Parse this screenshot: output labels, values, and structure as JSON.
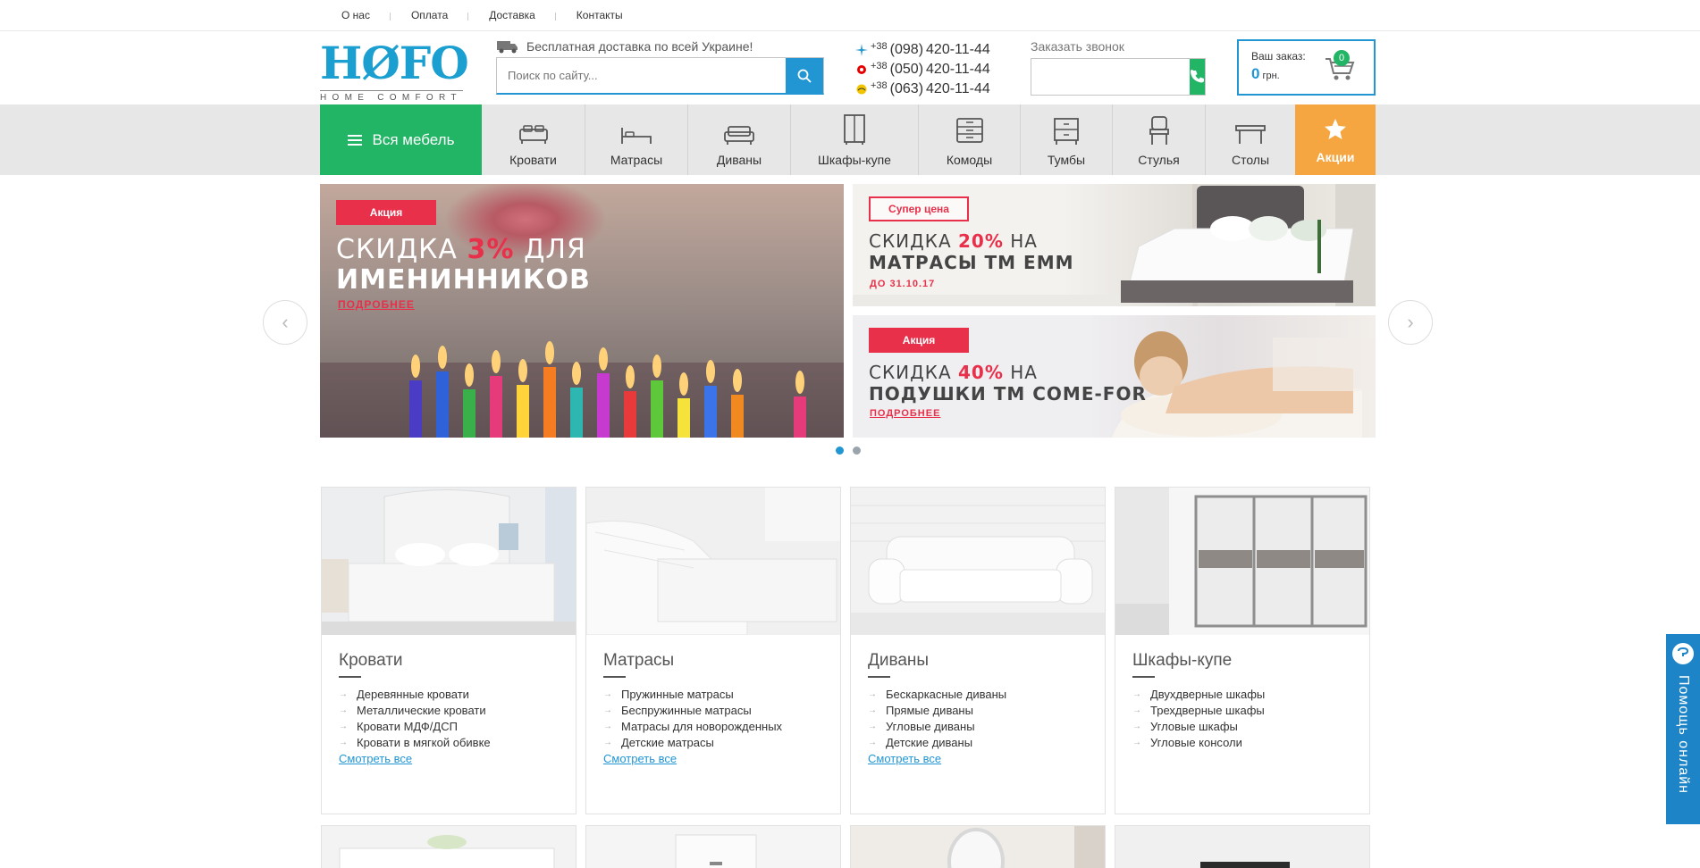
{
  "toplinks": [
    "О нас",
    "Оплата",
    "Доставка",
    "Контакты"
  ],
  "logo": {
    "mark": "HØFO",
    "sub": "HOME COMFORT"
  },
  "delivery": "Бесплатная доставка по всей Украине!",
  "search": {
    "placeholder": "Поиск по сайту..."
  },
  "phones": [
    {
      "prefix": "+38",
      "code": "(098)",
      "num": "420-11-44"
    },
    {
      "prefix": "+38",
      "code": "(050)",
      "num": "420-11-44"
    },
    {
      "prefix": "+38",
      "code": "(063)",
      "num": "420-11-44"
    }
  ],
  "callback": {
    "label": "Заказать звонок"
  },
  "cart": {
    "title": "Ваш заказ:",
    "amount": "0",
    "currency": "грн.",
    "count": "0"
  },
  "nav": {
    "all": "Вся мебель",
    "items": [
      "Кровати",
      "Матрасы",
      "Диваны",
      "Шкафы-купе",
      "Комоды",
      "Тумбы",
      "Стулья",
      "Столы"
    ],
    "sale": "Акции"
  },
  "banners": {
    "main": {
      "tag": "Акция",
      "line1a": "СКИДКА ",
      "line1b": "3%",
      "line1c": " ДЛЯ",
      "line2": "ИМЕНИННИКОВ",
      "more": "ПОДРОБНЕЕ"
    },
    "side1": {
      "tag": "Супер цена",
      "line1a": "СКИДКА ",
      "line1b": "20%",
      "line1c": " НА",
      "line2": "МАТРАСЫ ТМ EMM",
      "note": "ДО 31.10.17"
    },
    "side2": {
      "tag": "Акция",
      "line1a": "СКИДКА ",
      "line1b": "40%",
      "line1c": " НА",
      "line2": "ПОДУШКИ ТМ COME-FOR",
      "more": "ПОДРОБНЕЕ"
    }
  },
  "categories": [
    {
      "title": "Кровати",
      "links": [
        "Деревянные кровати",
        "Металлические кровати",
        "Кровати МДФ/ДСП",
        "Кровати в мягкой обивке"
      ],
      "all": "Смотреть все"
    },
    {
      "title": "Матрасы",
      "links": [
        "Пружинные матрасы",
        "Беспружинные матрасы",
        "Матрасы для новорожденных",
        "Детские матрасы"
      ],
      "all": "Смотреть все"
    },
    {
      "title": "Диваны",
      "links": [
        "Бескаркасные диваны",
        "Прямые диваны",
        "Угловые диваны",
        "Детские диваны"
      ],
      "all": "Смотреть все"
    },
    {
      "title": "Шкафы-купе",
      "links": [
        "Двухдверные шкафы",
        "Трехдверные шкафы",
        "Угловые шкафы",
        "Угловые консоли"
      ],
      "all": ""
    }
  ],
  "help": "Помощь онлайн",
  "colors": {
    "accent": "#2196d3",
    "green": "#21b565",
    "orange": "#f6a640",
    "red": "#e8304a"
  }
}
